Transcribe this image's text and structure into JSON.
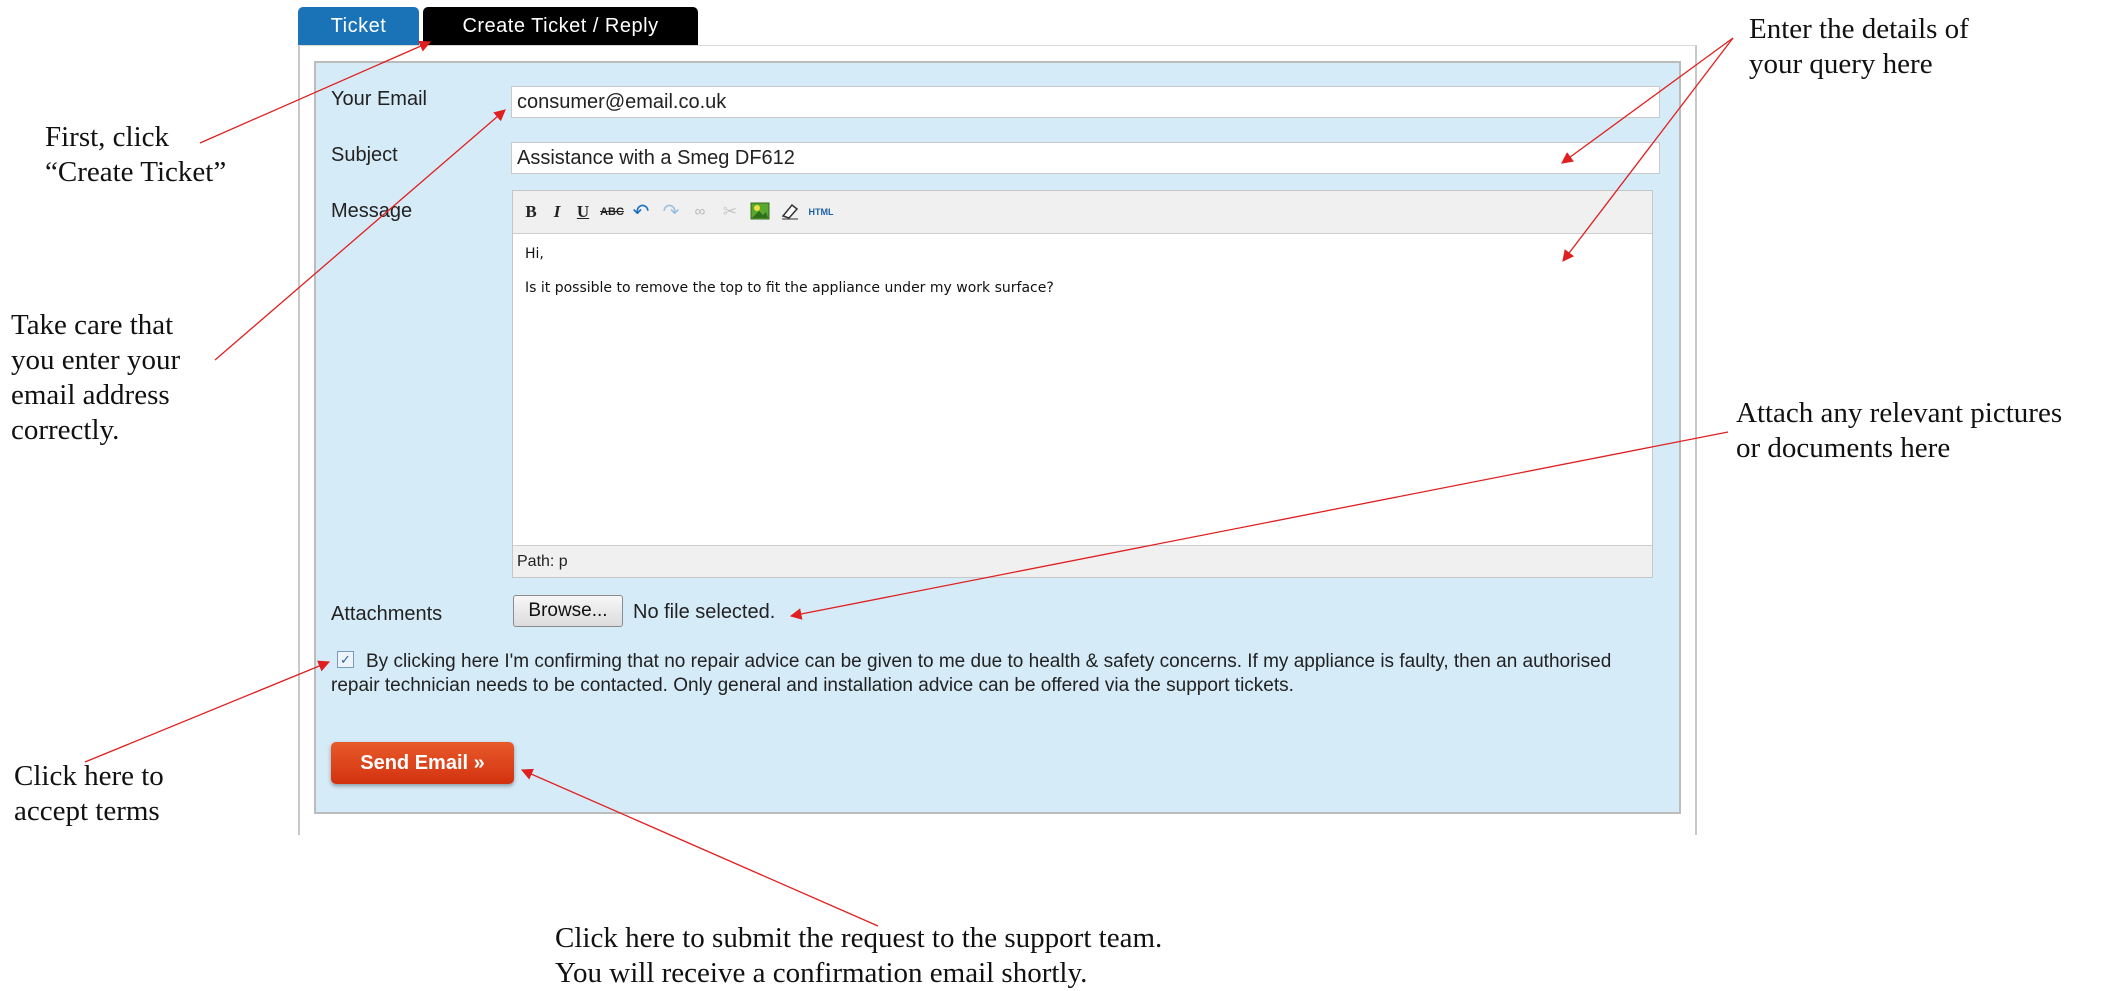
{
  "tabs": {
    "ticket": "Ticket",
    "create": "Create Ticket / Reply"
  },
  "form": {
    "email_label": "Your Email",
    "email_value": "consumer@email.co.uk",
    "subject_label": "Subject",
    "subject_value": "Assistance with a Smeg DF612",
    "message_label": "Message",
    "message_lines": [
      "Hi,",
      "Is it possible to remove the top to fit the appliance under my work surface?"
    ],
    "status_path": "Path: p",
    "attachments_label": "Attachments",
    "browse_label": "Browse...",
    "no_file": "No file selected.",
    "terms_text": "By clicking here I'm confirming that no repair advice can be given to me due to health & safety concerns. If my appliance is faulty, then an authorised repair technician needs to be contacted. Only general and installation advice can be offered via the support tickets.",
    "terms_checked": true,
    "send_label": "Send Email »"
  },
  "toolbar": {
    "bold": "B",
    "italic": "I",
    "underline": "U",
    "strike": "ABC",
    "html": "HTML"
  },
  "annotations": {
    "first_click": "First, click\n“Create Ticket”",
    "email_care": "Take care that\nyou enter your\nemail address\ncorrectly.",
    "details": "Enter the details of\nyour query here",
    "attach": "Attach any relevant pictures\nor documents here",
    "accept": "Click here to\naccept terms",
    "submit": "Click here to submit the request to the support team.\nYou will receive a confirmation email shortly."
  },
  "colors": {
    "tab_blue": "#1a73b6",
    "panel_bg": "#d6ebf8",
    "send_red": "#d93512",
    "arrow": "#e02020"
  }
}
